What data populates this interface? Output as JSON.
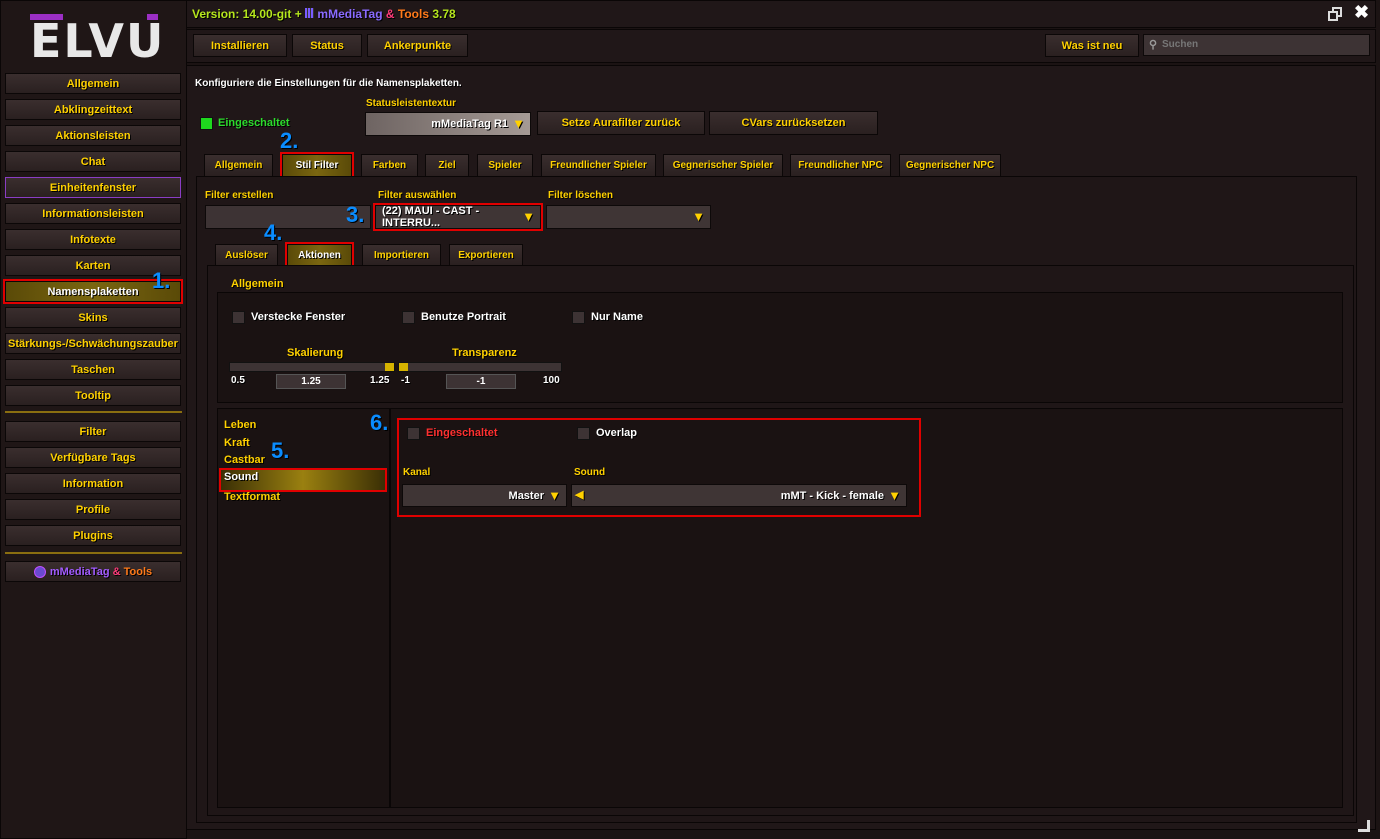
{
  "logo": "ELVU",
  "title": {
    "version": "Version: 14.00-git +",
    "plugin": "mMediaTag",
    "amp": "&",
    "tools": "Tools",
    "plugin_version": "3.78"
  },
  "sidebar": {
    "items": [
      {
        "label": "Allgemein"
      },
      {
        "label": "Abklingzeittext"
      },
      {
        "label": "Aktionsleisten"
      },
      {
        "label": "Chat"
      },
      {
        "label": "Einheitenfenster"
      },
      {
        "label": "Informationsleisten"
      },
      {
        "label": "Infotexte"
      },
      {
        "label": "Karten"
      },
      {
        "label": "Namensplaketten"
      },
      {
        "label": "Skins"
      },
      {
        "label": "Stärkungs-/Schwächungszauber"
      },
      {
        "label": "Taschen"
      },
      {
        "label": "Tooltip"
      }
    ],
    "items2": [
      {
        "label": "Filter"
      },
      {
        "label": "Verfügbare Tags"
      },
      {
        "label": "Information"
      },
      {
        "label": "Profile"
      },
      {
        "label": "Plugins"
      }
    ],
    "plugin": {
      "name": "mMediaTag",
      "amp": "&",
      "tools": "Tools"
    }
  },
  "toolbar": {
    "install": "Installieren",
    "status": "Status",
    "anchors": "Ankerpunkte",
    "whats_new": "Was ist neu",
    "search_placeholder": "Suchen"
  },
  "main": {
    "description": "Konfiguriere die Einstellungen für die Namensplaketten.",
    "enabled": "Eingeschaltet",
    "statusbar_texture_label": "Statusleistentextur",
    "statusbar_texture_value": "mMediaTag R1",
    "reset_aura": "Setze Aurafilter zurück",
    "reset_cvars": "CVars zurücksetzen",
    "tabs": [
      "Allgemein",
      "Stil Filter",
      "Farben",
      "Ziel",
      "Spieler",
      "Freundlicher Spieler",
      "Gegnerischer Spieler",
      "Freundlicher NPC",
      "Gegnerischer NPC"
    ],
    "filter_create_label": "Filter erstellen",
    "filter_select_label": "Filter auswählen",
    "filter_select_value": "(22) MAUI - CAST - INTERRU...",
    "filter_delete_label": "Filter löschen",
    "subtabs": [
      "Auslöser",
      "Aktionen",
      "Importieren",
      "Exportieren"
    ],
    "general": {
      "heading": "Allgemein",
      "hide_frame": "Verstecke Fenster",
      "use_portrait": "Benutze Portrait",
      "name_only": "Nur Name",
      "scale": {
        "label": "Skalierung",
        "min": "0.5",
        "value": "1.25",
        "max": "1.25",
        "fraction": 1.0
      },
      "alpha": {
        "label": "Transparenz",
        "min": "-1",
        "value": "-1",
        "max": "100",
        "fraction": 0.0
      }
    },
    "sections": [
      "Leben",
      "Kraft",
      "Castbar",
      "Sound",
      "Textformat"
    ],
    "sound": {
      "enabled": "Eingeschaltet",
      "overlap": "Overlap",
      "channel_label": "Kanal",
      "channel_value": "Master",
      "sound_label": "Sound",
      "sound_value": "mMT - Kick - female"
    }
  },
  "annotations": [
    "1.",
    "2.",
    "3.",
    "4.",
    "5.",
    "6."
  ]
}
